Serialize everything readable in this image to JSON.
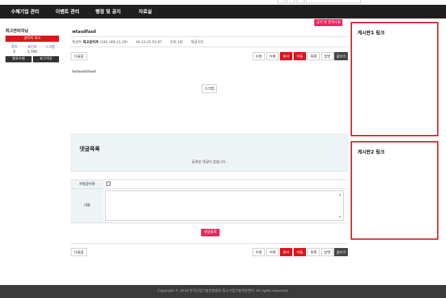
{
  "nav": {
    "items": [
      "수혜기업 관리",
      "이벤트 관리",
      "행정 및 공지",
      "자료실"
    ]
  },
  "user": {
    "name": "최고관리자님",
    "admin_button": "관리자 모드",
    "stats": [
      {
        "label": "쪽지",
        "value": "0"
      },
      {
        "label": "포인트",
        "value": "2,700"
      },
      {
        "label": "스크랩",
        "value": ""
      }
    ],
    "edit_button": "정보수정",
    "logout_button": "로그아웃"
  },
  "post": {
    "notice_button": "공지 및 연혁사항",
    "title": "wtasdfasd",
    "meta": {
      "author_label": "작성자",
      "author": "최고관리자",
      "ip": "(192.168.11.29)",
      "date": "14-12-21 02:47",
      "views": "조회 1회",
      "comments": "댓글 0건"
    },
    "body": "fsefasefsfesef",
    "scrap_button": "스크랩"
  },
  "toolbar": {
    "next": "다음글",
    "edit": "수정",
    "delete": "삭제",
    "copy": "복사",
    "move": "이동",
    "list": "목록",
    "reply": "답변",
    "write": "글쓰기"
  },
  "comments": {
    "title": "댓글목록",
    "empty": "등록된 댓글이 없습니다."
  },
  "form": {
    "secret_label": "비밀글사용",
    "content_label": "내용",
    "submit": "댓글등록"
  },
  "side": {
    "box1_title": "게시판1 링크",
    "box2_title": "게시판2 링크"
  },
  "footer": {
    "copyright": "Copyright © 2014 한국산업기술진흥협회 중소기업기술지원센터. All rights reserved."
  },
  "colors": {
    "nav_bg": "#1f1f1f",
    "accent_red": "#d9161c",
    "accent_pink": "#e8265a",
    "outline_red": "#d7262b",
    "footer_bg": "#3b3b3b"
  }
}
